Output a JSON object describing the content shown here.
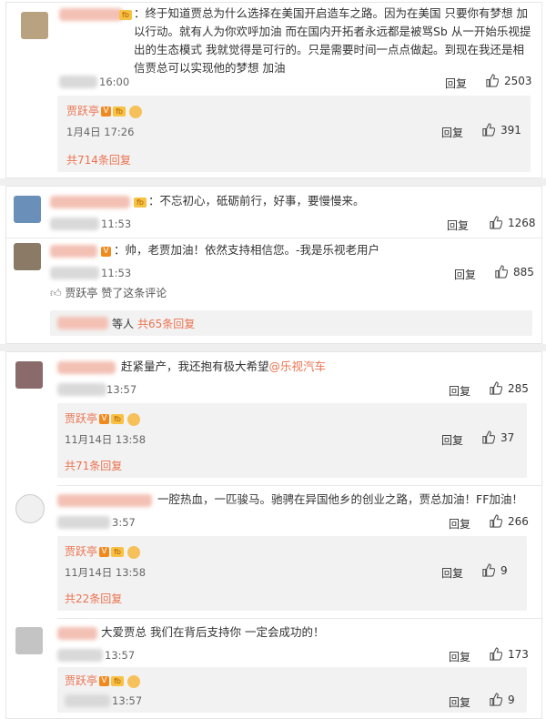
{
  "c1": {
    "text": "：终于知道贾总为什么选择在美国开启造车之路。因为在美国 只要你有梦想 加以行动。就有人为你欢呼加油 而在国内开拓者永远都是被骂Sb 从一开始乐视提出的生态模式 我就觉得是可行的。只是需要时间一点点做起。到现在我还是相信贾总可以实现他的梦想 加油",
    "time": "16:00",
    "reply": "回复",
    "likes": "2503",
    "sub": {
      "name": "贾跃亭",
      "time": "1月4日 17:26",
      "reply": "回复",
      "likes": "391"
    },
    "more": "共714条回复"
  },
  "c2": {
    "text": "：不忘初心，砥砺前行，好事，要慢慢来。",
    "time": "11:53",
    "reply": "回复",
    "likes": "1268"
  },
  "c3": {
    "text": "：帅，老贾加油！依然支持相信您。-我是乐视老用户",
    "time": "11:53",
    "reply": "回复",
    "likes": "885",
    "liked_by_name": "贾跃亭",
    "liked_by_text": "赞了这条评论",
    "others_prefix": "等人",
    "others_count": "共65条回复"
  },
  "c4": {
    "text_prefix": "赶紧量产，我还抱有极大希望",
    "mention": "@乐视汽车",
    "time": "13:57",
    "reply": "回复",
    "likes": "285",
    "sub": {
      "name": "贾跃亭",
      "time": "11月14日 13:58",
      "reply": "回复",
      "likes": "37"
    },
    "more": "共71条回复"
  },
  "c5": {
    "text": "一腔热血，一匹骏马。驰骋在异国他乡的创业之路，贾总加油！FF加油！",
    "time": "3:57",
    "reply": "回复",
    "likes": "266",
    "sub": {
      "name": "贾跃亭",
      "time": "11月14日 13:58",
      "reply": "回复",
      "likes": "9"
    },
    "more": "共22条回复"
  },
  "c6": {
    "text": "大爱贾总 我们在背后支持你 一定会成功的！",
    "time": "13:57",
    "reply": "回复",
    "likes": "173",
    "sub": {
      "name": "贾跃亭",
      "time": "13:57",
      "reply": "回复",
      "likes": "9"
    }
  },
  "colors": {
    "accent": "#eb7350",
    "bg_gap": "#efefef",
    "reply_bg": "#f2f2f2"
  }
}
